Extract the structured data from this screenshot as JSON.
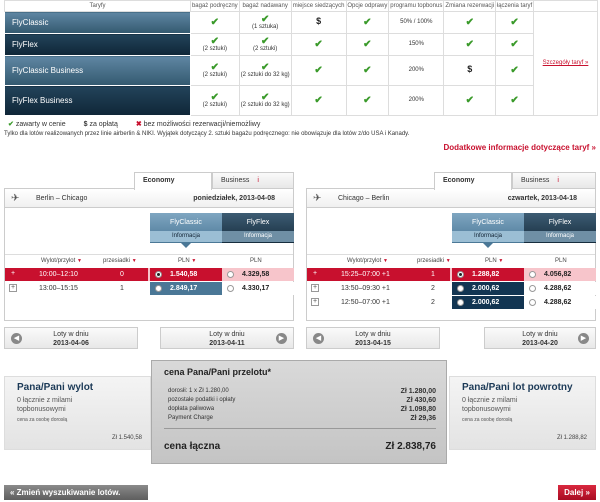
{
  "tariffs": {
    "headers": [
      "Taryfy",
      "bagaż podręczny",
      "bagaż nadawany",
      "miejsce siedzących",
      "Opcje odprawy",
      "programu topbonus",
      "Zmiana rezerwacji",
      "łączenia taryf"
    ],
    "rows": [
      {
        "name": "FlyClassic",
        "hand": "",
        "checked": "(1 sztuka)",
        "seat": "$",
        "checkin": "",
        "bonus": "50% / 100%",
        "change": "",
        "combine": ""
      },
      {
        "name": "FlyFlex",
        "hand": "(2 sztuki)",
        "checked": "(2 sztuki)",
        "seat": "",
        "checkin": "",
        "bonus": "150%",
        "change": "",
        "combine": ""
      },
      {
        "name": "FlyClassic Business",
        "hand": "(2 sztuki)",
        "checked": "(2 sztuki do 32 kg)",
        "seat": "",
        "checkin": "",
        "bonus": "200%",
        "change": "$",
        "combine": ""
      },
      {
        "name": "FlyFlex Business",
        "hand": "(2 sztuki)",
        "checked": "(2 sztuki do 32 kg)",
        "seat": "",
        "checkin": "",
        "bonus": "200%",
        "change": "",
        "combine": ""
      }
    ],
    "details_link": "Szczegóły taryf »"
  },
  "legend": {
    "included": "zawarty w cenie",
    "paid": "za opłatą",
    "not": "bez możliwości rezerwacji/niemożliwy"
  },
  "note": "Tylko dla lotów realizowanych przez linie airberlin & NIKI. Wyjątek dotyczący 2. sztuki bagażu podręcznego: nie obowiązuje dla lotów z/do USA i Kanady.",
  "more_info": "Dodatkowe informacje dotyczące taryf »",
  "outbound": {
    "tab_economy": "Economy",
    "tab_business": "Business",
    "info_icon": "i",
    "route": "Berlin – Chicago",
    "date": "poniedziałek, 2013-04-08",
    "fares": [
      {
        "name": "FlyClassic",
        "info": "Informacja"
      },
      {
        "name": "FlyFlex",
        "info": "Informacja"
      }
    ],
    "col_departure": "Wylot/przylot",
    "col_stops": "przesiadki",
    "col_pln1": "PLN",
    "col_pln2": "PLN",
    "flights": [
      {
        "time": "10:00–12:10",
        "stops": "0",
        "p1": "1.540,58",
        "p2": "4.329,58"
      },
      {
        "time": "13:00–15:15",
        "stops": "1",
        "p1": "2.849,17",
        "p2": "4.330,17"
      }
    ],
    "prev_label": "Loty w dniu",
    "prev_date": "2013-04-06",
    "next_label": "Loty w dniu",
    "next_date": "2013-04-11"
  },
  "inbound": {
    "tab_economy": "Economy",
    "tab_business": "Business",
    "info_icon": "i",
    "route": "Chicago – Berlin",
    "date": "czwartek, 2013-04-18",
    "fares": [
      {
        "name": "FlyClassic",
        "info": "Informacja"
      },
      {
        "name": "FlyFlex",
        "info": "Informacja"
      }
    ],
    "col_departure": "Wylot/przylot",
    "col_stops": "przesiadki",
    "col_pln1": "PLN",
    "col_pln2": "PLN",
    "flights": [
      {
        "time": "15:25–07:00 +1",
        "stops": "1",
        "p1": "1.288,82",
        "p2": "4.056,82"
      },
      {
        "time": "13:50–09:30 +1",
        "stops": "2",
        "p1": "2.000,62",
        "p2": "4.288,62"
      },
      {
        "time": "12:50–07:00 +1",
        "stops": "2",
        "p1": "2.000,62",
        "p2": "4.288,62"
      }
    ],
    "prev_label": "Loty w dniu",
    "prev_date": "2013-04-15",
    "next_label": "Loty w dniu",
    "next_date": "2013-04-20"
  },
  "summary_out": {
    "title": "Pana/Pani wylot",
    "sub1": "0 łącznie z milami",
    "sub2": "topbonusowymi",
    "adult": "cena za osobę dorosłą",
    "amount": "Zł 1.540,58"
  },
  "summary_center": {
    "title": "cena Pana/Pani przelotu*",
    "lines": [
      {
        "label": "dorosłi: 1 x Zł 1.280,00",
        "value": "Zł 1.280,00"
      },
      {
        "label": "pozostałe podatki i opłaty",
        "value": "Zł 430,60"
      },
      {
        "label": "dopłata paliwowa",
        "value": "Zł 1.098,80"
      },
      {
        "label": "Payment Charge",
        "value": "Zł 29,36"
      }
    ],
    "total_label": "cena łączna",
    "total_value": "Zł 2.838,76"
  },
  "summary_in": {
    "title": "Pana/Pani lot powrotny",
    "sub1": "0 łącznie z milami",
    "sub2": "topbonusowymi",
    "adult": "cena za osobę dorosłą",
    "amount": "Zł 1.288,82"
  },
  "buttons": {
    "back": "« Zmień wyszukiwanie lotów.",
    "next": "Dalej »"
  },
  "colors": {
    "brand_red": "#c8102e",
    "navy": "#1c3a57",
    "check_green": "#3a9a2a"
  }
}
